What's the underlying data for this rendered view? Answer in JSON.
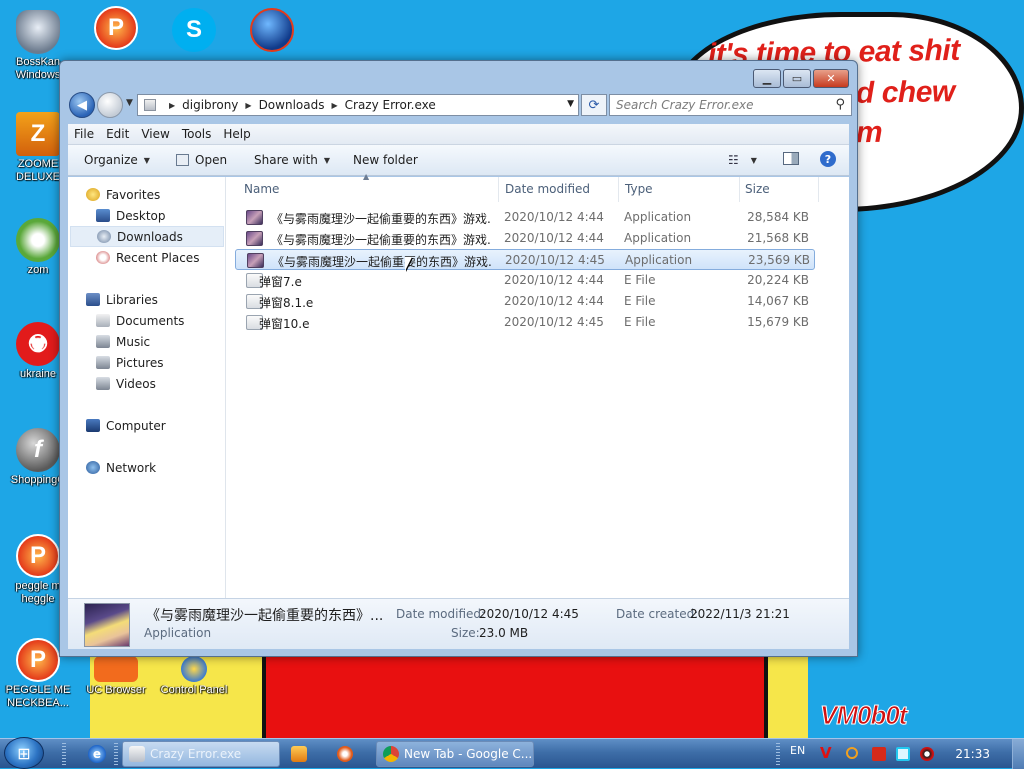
{
  "wallpaper": {
    "line1": "it's time to eat shit",
    "line2": "d chew",
    "line3": "m",
    "signature": "VM0b0t"
  },
  "desktop_icons": [
    {
      "label": "BossKan Windows",
      "icon": "bosskan-icon"
    },
    {
      "label": "ZOOME DELUXE",
      "icon": "zoome-icon"
    },
    {
      "label": "zom",
      "icon": "zombie-plant-icon"
    },
    {
      "label": "ukraine",
      "icon": "radiation-icon"
    },
    {
      "label": "ShoppingC",
      "icon": "flash-icon"
    },
    {
      "label": "peggle m heggle",
      "icon": "peggle-icon"
    },
    {
      "label": "PEGGLE ME NECKBEA...",
      "icon": "peggle-icon"
    },
    {
      "label": "UC Browser",
      "icon": "uc-browser-icon"
    },
    {
      "label": "Control Panel",
      "icon": "control-panel-icon"
    }
  ],
  "window": {
    "address": {
      "crumbs": [
        "digibrony",
        "Downloads",
        "Crazy Error.exe"
      ]
    },
    "search_placeholder": "Search Crazy Error.exe",
    "menu": [
      "File",
      "Edit",
      "View",
      "Tools",
      "Help"
    ],
    "toolbar": {
      "organize": "Organize",
      "open": "Open",
      "share_with": "Share with",
      "new_folder": "New folder"
    },
    "nav": {
      "favorites": "Favorites",
      "desktop": "Desktop",
      "downloads": "Downloads",
      "recent_places": "Recent Places",
      "libraries": "Libraries",
      "documents": "Documents",
      "music": "Music",
      "pictures": "Pictures",
      "videos": "Videos",
      "computer": "Computer",
      "network": "Network"
    },
    "columns": {
      "name": "Name",
      "date": "Date modified",
      "type": "Type",
      "size": "Size"
    },
    "files": [
      {
        "name": "《与雾雨魔理沙一起偷重要的东西》游戏...",
        "date": "2020/10/12 4:44",
        "type": "Application",
        "size": "28,584 KB",
        "kind": "app"
      },
      {
        "name": "《与雾雨魔理沙一起偷重要的东西》游戏...",
        "date": "2020/10/12 4:44",
        "type": "Application",
        "size": "21,568 KB",
        "kind": "app"
      },
      {
        "name": "《与雾雨魔理沙一起偷重要的东西》游戏...",
        "date": "2020/10/12 4:45",
        "type": "Application",
        "size": "23,569 KB",
        "kind": "app",
        "selected": true
      },
      {
        "name": "弹窗7.e",
        "date": "2020/10/12 4:44",
        "type": "E File",
        "size": "20,224 KB",
        "kind": "efile"
      },
      {
        "name": "弹窗8.1.e",
        "date": "2020/10/12 4:44",
        "type": "E File",
        "size": "14,067 KB",
        "kind": "efile"
      },
      {
        "name": "弹窗10.e",
        "date": "2020/10/12 4:45",
        "type": "E File",
        "size": "15,679 KB",
        "kind": "efile"
      }
    ],
    "details": {
      "name": "《与雾雨魔理沙一起偷重要的东西》...",
      "type": "Application",
      "date_modified_label": "Date modified:",
      "date_modified": "2020/10/12 4:45",
      "size_label": "Size:",
      "size": "23.0 MB",
      "date_created_label": "Date created:",
      "date_created": "2022/11/3 21:21"
    }
  },
  "taskbar": {
    "tasks": [
      {
        "label": "Crazy Error.exe",
        "icon": "folder-icon"
      },
      {
        "label": "",
        "icon": "media-player-icon"
      },
      {
        "label": "",
        "icon": "game-icon"
      },
      {
        "label": "New Tab - Google C...",
        "icon": "chrome-icon"
      }
    ],
    "language": "EN",
    "clock": "21:33"
  },
  "colors": {
    "desktop_bg": "#1ea6e6",
    "selection": "#cfe3fa",
    "wall_text": "#e0201a"
  }
}
